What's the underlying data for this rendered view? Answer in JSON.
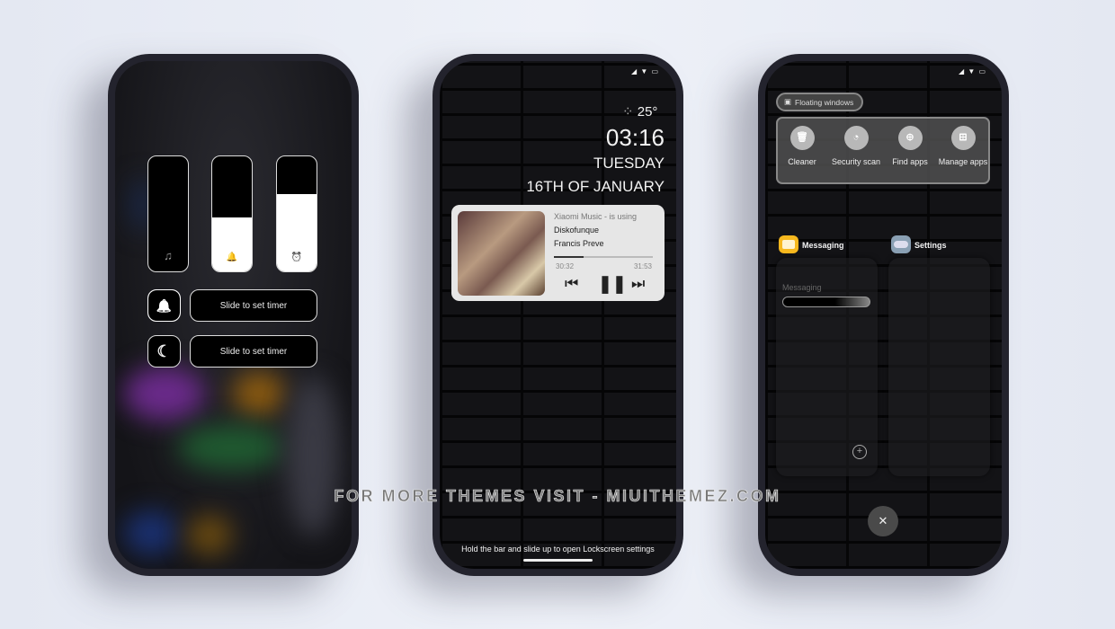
{
  "phone1": {
    "volume": [
      {
        "icon": "music-note-icon",
        "glyph": "♫",
        "level": 0
      },
      {
        "icon": "bell-icon",
        "glyph": "🔔",
        "level": 0.47
      },
      {
        "icon": "alarm-clock-icon",
        "glyph": "⏰",
        "level": 0.67
      }
    ],
    "timers": [
      {
        "icon": "bell-icon",
        "glyph": "🔔",
        "label": "Slide to set timer"
      },
      {
        "icon": "moon-icon",
        "glyph": "☾",
        "label": "Slide to set timer"
      }
    ]
  },
  "phone2": {
    "weather_temp": "25°",
    "time": "03:16",
    "day": "TUESDAY",
    "date": "16TH OF JANUARY",
    "music": {
      "source": "Xiaomi Music - is using",
      "title": "Diskofunque",
      "artist": "Francis Preve",
      "elapsed": "30:32",
      "duration": "31:53",
      "progress": 0.3
    },
    "hint": "Hold the bar  and slide up to open Lockscreen settings"
  },
  "phone3": {
    "floating_windows": "Floating windows",
    "quick_actions": [
      {
        "icon": "trash-icon",
        "glyph": "🗑",
        "label": "Cleaner"
      },
      {
        "icon": "gauge-icon",
        "glyph": "◔",
        "label": "Security scan"
      },
      {
        "icon": "search-apps-icon",
        "glyph": "⊕",
        "label": "Find apps"
      },
      {
        "icon": "grid-icon",
        "glyph": "⊞",
        "label": "Manage apps"
      }
    ],
    "recent_apps": [
      {
        "name": "Messaging",
        "icon_color": "#f7b81e"
      },
      {
        "name": "Settings",
        "icon_color": "#8aa0b4"
      }
    ],
    "messaging_card_label": "Messaging"
  },
  "watermark": "FOR MORE THEMES VISIT - MIUITHEMEZ.COM"
}
